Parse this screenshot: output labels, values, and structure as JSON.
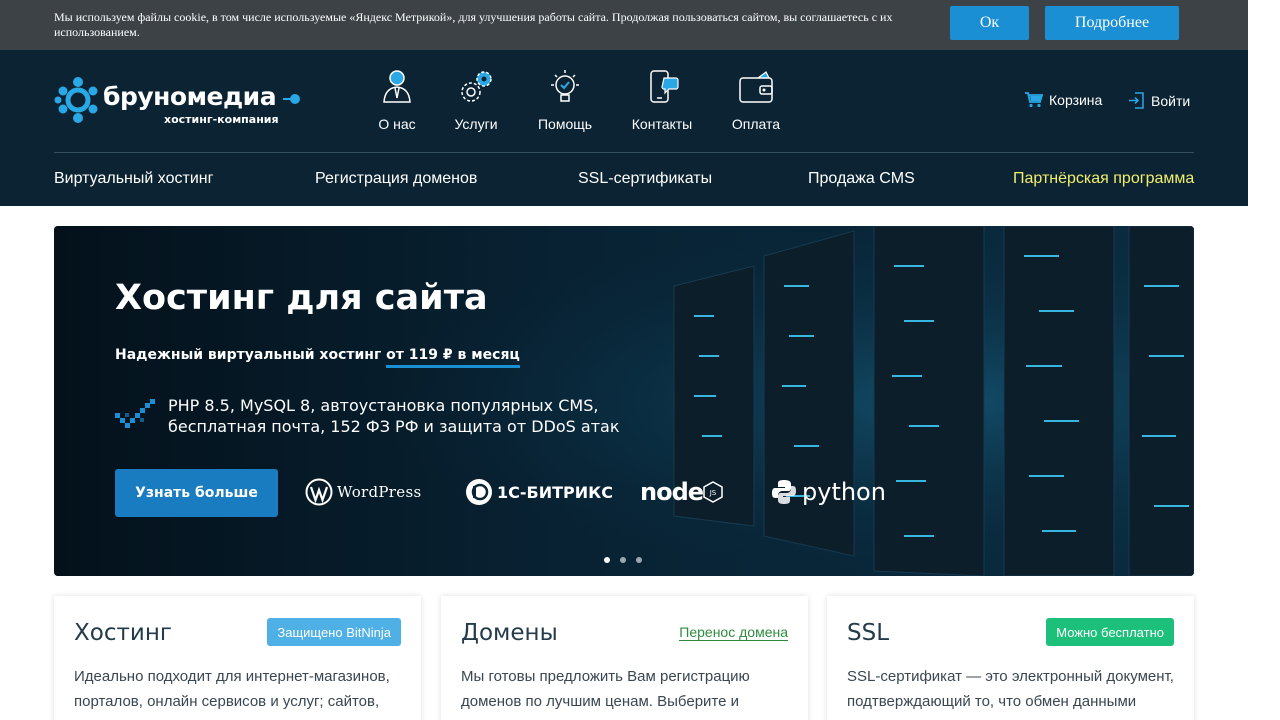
{
  "colors": {
    "cookie_bg": "#3d4247",
    "header_bg": "#0b2332",
    "accent": "#1a8fd3",
    "nav_highlight": "#f0ee6e",
    "badge_bitninja": "#4fb0e6",
    "badge_free": "#1dc07b",
    "link_green": "#2e8b3e"
  },
  "cookie": {
    "text": "Мы используем файлы cookie, в том числе используемые «Яндекс Метрикой», для улучшения работы сайта. Продолжая пользоваться сайтом, вы соглашаетесь с их использованием.",
    "ok_label": "Ок",
    "more_label": "Подробнее"
  },
  "logo": {
    "name": "бруномедиа",
    "subtitle": "хостинг-компания"
  },
  "topnav": [
    {
      "label": "О нас",
      "icon": "person-icon"
    },
    {
      "label": "Услуги",
      "icon": "gears-icon"
    },
    {
      "label": "Помощь",
      "icon": "lightbulb-icon"
    },
    {
      "label": "Контакты",
      "icon": "phone-chat-icon"
    },
    {
      "label": "Оплата",
      "icon": "wallet-icon"
    }
  ],
  "account": {
    "cart_label": "Корзина",
    "login_label": "Войти"
  },
  "mainnav": [
    {
      "label": "Виртуальный хостинг"
    },
    {
      "label": "Регистрация доменов"
    },
    {
      "label": "SSL-сертификаты"
    },
    {
      "label": "Продажа CMS"
    },
    {
      "label": "Партнёрская программа"
    }
  ],
  "hero": {
    "title": "Хостинг для сайта",
    "subtitle_prefix": "Надежный виртуальный хостинг ",
    "subtitle_price": "от 119 ₽ в месяц",
    "features_line1": "PHP 8.5, MySQL 8, автоустановка популярных CMS,",
    "features_line2": "бесплатная почта, 152 ФЗ РФ и защита от DDoS атак",
    "button_label": "Узнать больше",
    "tech": {
      "wordpress": "WordPress",
      "bitrix": "1С-БИТРИКС",
      "node": "node",
      "python": "python"
    },
    "slides_total": 3,
    "active_slide": 1
  },
  "cards": [
    {
      "title": "Хостинг",
      "badge": "Защищено BitNinja",
      "text": "Идеально подходит для интернет-магазинов, порталов, онлайн сервисов и услуг; сайтов,"
    },
    {
      "title": "Домены",
      "link": "Перенос домена",
      "text": "Мы готовы предложить Вам регистрацию доменов по лучшим ценам. Выберите и"
    },
    {
      "title": "SSL",
      "badge": "Можно бесплатно",
      "text": "SSL-сертификат — это электронный документ, подтверждающий то, что обмен данными"
    }
  ]
}
